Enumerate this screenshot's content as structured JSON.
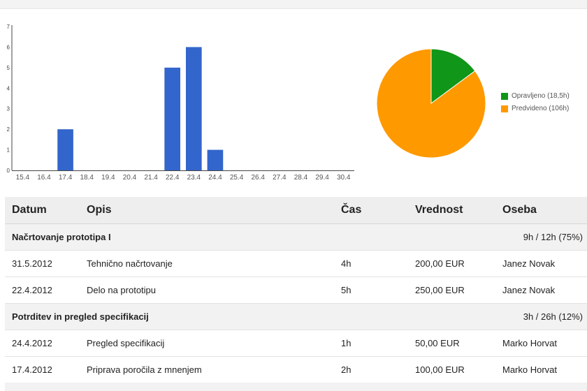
{
  "chart_data": [
    {
      "type": "bar",
      "categories": [
        "15.4",
        "16.4",
        "17.4",
        "18.4",
        "19.4",
        "20.4",
        "21.4",
        "22.4",
        "23.4",
        "24.4",
        "25.4",
        "26.4",
        "27.4",
        "28.4",
        "29.4",
        "30.4"
      ],
      "values": [
        0,
        0,
        2,
        0,
        0,
        0,
        0,
        5,
        6,
        1,
        0,
        0,
        0,
        0,
        0,
        0
      ],
      "ylim": [
        0,
        7
      ],
      "yticks": [
        0,
        1,
        2,
        3,
        4,
        5,
        6,
        7
      ],
      "color": "#3366cc"
    },
    {
      "type": "pie",
      "labels": [
        "Opravljeno (18,5h)",
        "Predvideno (106h)"
      ],
      "values": [
        18.5,
        106
      ],
      "colors": [
        "#109618",
        "#ff9900"
      ],
      "legend": "right"
    }
  ],
  "table": {
    "headers": {
      "date": "Datum",
      "desc": "Opis",
      "time": "Čas",
      "value": "Vrednost",
      "person": "Oseba"
    },
    "groups": [
      {
        "title": "Načrtovanje prototipa I",
        "progress": "9h / 12h (75%)",
        "rows": [
          {
            "date": "31.5.2012",
            "desc": "Tehnično načrtovanje",
            "time": "4h",
            "value": "200,00 EUR",
            "person": "Janez Novak"
          },
          {
            "date": "22.4.2012",
            "desc": "Delo na prototipu",
            "time": "5h",
            "value": "250,00 EUR",
            "person": "Janez Novak"
          }
        ]
      },
      {
        "title": "Potrditev in pregled specifikacij",
        "progress": "3h / 26h (12%)",
        "rows": [
          {
            "date": "24.4.2012",
            "desc": "Pregled specifikacij",
            "time": "1h",
            "value": "50,00 EUR",
            "person": "Marko Horvat"
          },
          {
            "date": "17.4.2012",
            "desc": "Priprava poročila z mnenjem",
            "time": "2h",
            "value": "100,00 EUR",
            "person": "Marko Horvat"
          }
        ]
      }
    ]
  }
}
